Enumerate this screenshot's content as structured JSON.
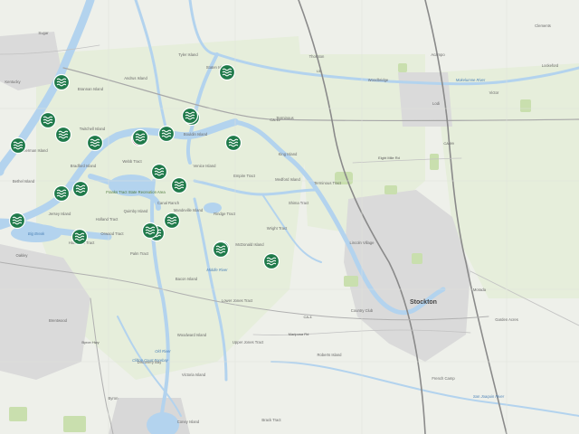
{
  "map": {
    "colors": {
      "land": "#eef0ea",
      "farm": "#e9efdc",
      "water": "#b3d3ee",
      "water_dark": "#9cc4e6",
      "urban": "#dcdcdc",
      "park": "#cfe3b4",
      "road": "#ffffff",
      "road_major": "#b8b8b8",
      "marker_green": "#1f7a4a",
      "marker_red": "#8b1c2c"
    },
    "places": {
      "stockton": "Stockton",
      "lodi": "Lodi",
      "brentwood": "Brentwood",
      "oakley": "Oakley",
      "byron": "Byron",
      "acampo": "Acampo",
      "woodbridge": "Woodbridge",
      "lockeford": "Lockeford",
      "victor": "Victor",
      "thornton": "Thornton",
      "clements": "Clements",
      "lincoln_village": "Lincoln Village",
      "morada": "Morada",
      "country_club": "Country Club",
      "garden_acres": "Garden Acres",
      "terminous": "Terminous",
      "french_camp": "French Camp",
      "discovery_bay": "Discovery Bay",
      "kentucky": "Kentucky",
      "sugar": "Sugar"
    },
    "islands": {
      "tyler": "Tyler Island",
      "staten": "Staten Island",
      "andrus": "Andrus Island",
      "brannan": "Brannan Island",
      "twitchell": "Twitchell Island",
      "sherman": "Sherman Island",
      "bouldin": "Bouldin Island",
      "webb": "Webb Tract",
      "bradford": "Bradford Island",
      "venice": "Venice Island",
      "empire": "Empire Tract",
      "king": "King Island",
      "medford": "Medford Island",
      "jersey": "Jersey Island",
      "holland": "Holland Tract",
      "quimby": "Quimby Island",
      "mandeville": "Mandeville Island",
      "bacon": "Bacon Island",
      "mcdonald": "McDonald Island",
      "rindge": "Rindge Tract",
      "roberts": "Roberts Island",
      "union_upper": "Upper Jones Tract",
      "union_lower": "Lower Jones Tract",
      "woodward": "Woodward Island",
      "victoria": "Victoria Island",
      "bethel": "Bethel Island",
      "hotchkiss": "Hotchkiss Tract",
      "palm": "Palm Tract",
      "orwood": "Orwood Tract",
      "coney": "Coney Island",
      "shima": "Shima Tract",
      "wright": "Wright Tract",
      "franks": "Franks Tract State Recreation Area",
      "terminous_tract": "Terminous Tract",
      "brack": "Brack Tract",
      "canal_ranch": "Canal Ranch"
    },
    "water_names": {
      "big_break": "Big Break",
      "clifton": "Clifton Court Forebay",
      "mokelumne": "Mokelumne River",
      "old_river": "Old River",
      "middle_river": "Middle River",
      "san_joaquin": "San Joaquin River"
    },
    "roads": {
      "ca12": "CA-12",
      "i5": "I-5",
      "hwy99": "CA-99",
      "mariposa": "Mariposa Rd",
      "eight_mile": "Eight Mile Rd",
      "hwy4": "CA-4",
      "fourth_road": "Byron Hwy"
    },
    "markers": [
      {
        "id": "1",
        "status": "active",
        "icon": "water-sensor-icon"
      },
      {
        "id": "2",
        "status": "active",
        "icon": "water-sensor-icon"
      },
      {
        "id": "3",
        "status": "active",
        "icon": "water-sensor-icon"
      },
      {
        "id": "4",
        "status": "active",
        "icon": "water-sensor-icon"
      },
      {
        "id": "5",
        "status": "active",
        "icon": "water-sensor-icon"
      },
      {
        "id": "6",
        "status": "active",
        "icon": "water-sensor-icon"
      },
      {
        "id": "7",
        "status": "selected",
        "icon": "water-sensor-icon"
      },
      {
        "id": "8",
        "status": "active",
        "icon": "water-sensor-icon"
      },
      {
        "id": "9",
        "status": "active",
        "icon": "water-sensor-icon"
      },
      {
        "id": "10",
        "status": "active",
        "icon": "water-sensor-icon"
      },
      {
        "id": "11",
        "status": "active",
        "icon": "water-sensor-icon"
      },
      {
        "id": "12",
        "status": "active",
        "icon": "water-sensor-icon"
      },
      {
        "id": "13",
        "status": "active",
        "icon": "water-sensor-icon"
      },
      {
        "id": "14",
        "status": "active",
        "icon": "water-sensor-icon"
      },
      {
        "id": "15",
        "status": "active",
        "icon": "water-sensor-icon"
      },
      {
        "id": "16",
        "status": "active",
        "icon": "water-sensor-icon"
      },
      {
        "id": "17",
        "status": "active",
        "icon": "water-sensor-icon"
      },
      {
        "id": "18",
        "status": "active",
        "icon": "water-sensor-icon"
      },
      {
        "id": "19",
        "status": "active",
        "icon": "water-sensor-icon"
      },
      {
        "id": "20",
        "status": "active",
        "icon": "water-sensor-icon"
      },
      {
        "id": "21",
        "status": "active",
        "icon": "water-sensor-icon"
      },
      {
        "id": "22",
        "status": "active",
        "icon": "water-sensor-icon"
      },
      {
        "id": "23",
        "status": "active",
        "icon": "water-sensor-icon"
      },
      {
        "id": "24",
        "status": "active",
        "icon": "water-sensor-icon"
      }
    ]
  }
}
